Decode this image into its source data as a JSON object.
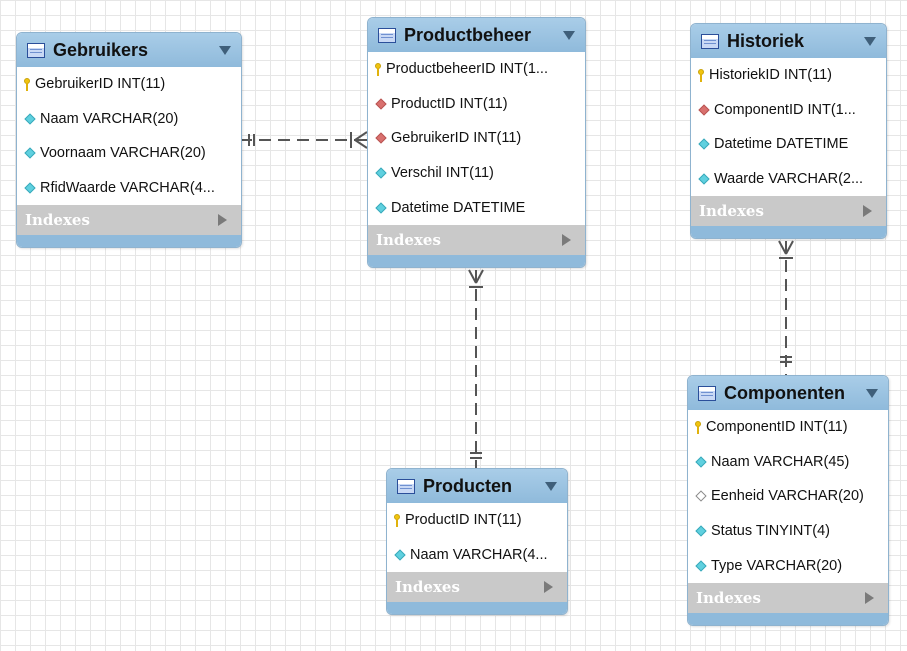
{
  "colors": {
    "header": "#8fbadb",
    "connector": "#555555",
    "primary_key": "#f1c40f",
    "foreign_key": "#d9706e",
    "not_null": "#5fd0df",
    "nullable": "#ffffff"
  },
  "tables": [
    {
      "title": "Gebruikers",
      "columns": [
        {
          "text": "GebruikerID INT(11)",
          "icon": "primary-key-icon"
        },
        {
          "text": "Naam VARCHAR(20)",
          "icon": "not-null-column-icon"
        },
        {
          "text": "Voornaam VARCHAR(20)",
          "icon": "not-null-column-icon"
        },
        {
          "text": "RfidWaarde VARCHAR(4...",
          "icon": "not-null-column-icon"
        }
      ],
      "indexes_label": "Indexes"
    },
    {
      "title": "Productbeheer",
      "columns": [
        {
          "text": "ProductbeheerID INT(1...",
          "icon": "primary-key-icon"
        },
        {
          "text": "ProductID INT(11)",
          "icon": "foreign-key-icon"
        },
        {
          "text": "GebruikerID INT(11)",
          "icon": "foreign-key-icon"
        },
        {
          "text": "Verschil INT(11)",
          "icon": "not-null-column-icon"
        },
        {
          "text": "Datetime DATETIME",
          "icon": "not-null-column-icon"
        }
      ],
      "indexes_label": "Indexes"
    },
    {
      "title": "Historiek",
      "columns": [
        {
          "text": "HistoriekID INT(11)",
          "icon": "primary-key-icon"
        },
        {
          "text": "ComponentID INT(1...",
          "icon": "foreign-key-icon"
        },
        {
          "text": "Datetime DATETIME",
          "icon": "not-null-column-icon"
        },
        {
          "text": "Waarde VARCHAR(2...",
          "icon": "not-null-column-icon"
        }
      ],
      "indexes_label": "Indexes"
    },
    {
      "title": "Producten",
      "columns": [
        {
          "text": "ProductID INT(11)",
          "icon": "primary-key-icon"
        },
        {
          "text": "Naam VARCHAR(4...",
          "icon": "not-null-column-icon"
        }
      ],
      "indexes_label": "Indexes"
    },
    {
      "title": "Componenten",
      "columns": [
        {
          "text": "ComponentID INT(11)",
          "icon": "primary-key-icon"
        },
        {
          "text": "Naam VARCHAR(45)",
          "icon": "not-null-column-icon"
        },
        {
          "text": "Eenheid VARCHAR(20)",
          "icon": "nullable-column-icon"
        },
        {
          "text": "Status TINYINT(4)",
          "icon": "not-null-column-icon"
        },
        {
          "text": "Type VARCHAR(20)",
          "icon": "not-null-column-icon"
        }
      ],
      "indexes_label": "Indexes"
    }
  ],
  "relationships": [
    {
      "from": "Gebruikers",
      "to": "Productbeheer",
      "from_cardinality": "one-and-only-one",
      "to_cardinality": "one-or-many"
    },
    {
      "from": "Producten",
      "to": "Productbeheer",
      "from_cardinality": "one-and-only-one",
      "to_cardinality": "one-or-many"
    },
    {
      "from": "Componenten",
      "to": "Historiek",
      "from_cardinality": "one-and-only-one",
      "to_cardinality": "one-or-many"
    }
  ]
}
